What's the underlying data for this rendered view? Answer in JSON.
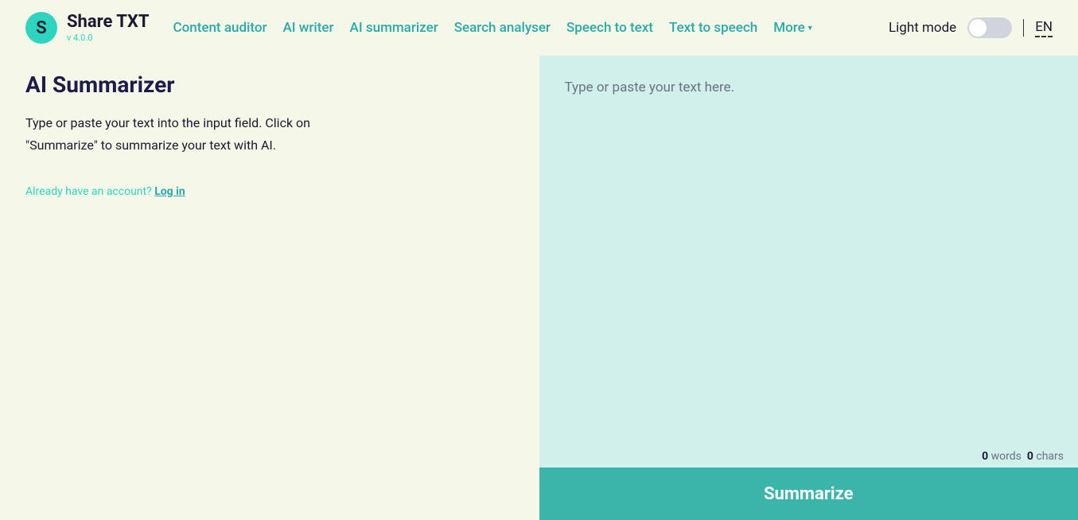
{
  "app": {
    "logo_letter": "S",
    "name": "Share TXT",
    "version": "v 4.0.0"
  },
  "nav": {
    "items": [
      "Content auditor",
      "AI writer",
      "AI summarizer",
      "Search analyser",
      "Speech to text",
      "Text to speech"
    ],
    "more_label": "More"
  },
  "header": {
    "theme_label": "Light mode",
    "language": "EN"
  },
  "main": {
    "title": "AI Summarizer",
    "description": "Type or paste your text into the input field. Click on \"Summarize\" to summarize your text with AI.",
    "account_prompt": "Already have an account? ",
    "login_label": "Log in"
  },
  "editor": {
    "placeholder": "Type or paste your text here.",
    "word_count": "0",
    "words_label": " words",
    "char_count": "0",
    "chars_label": " chars",
    "button_label": "Summarize"
  }
}
